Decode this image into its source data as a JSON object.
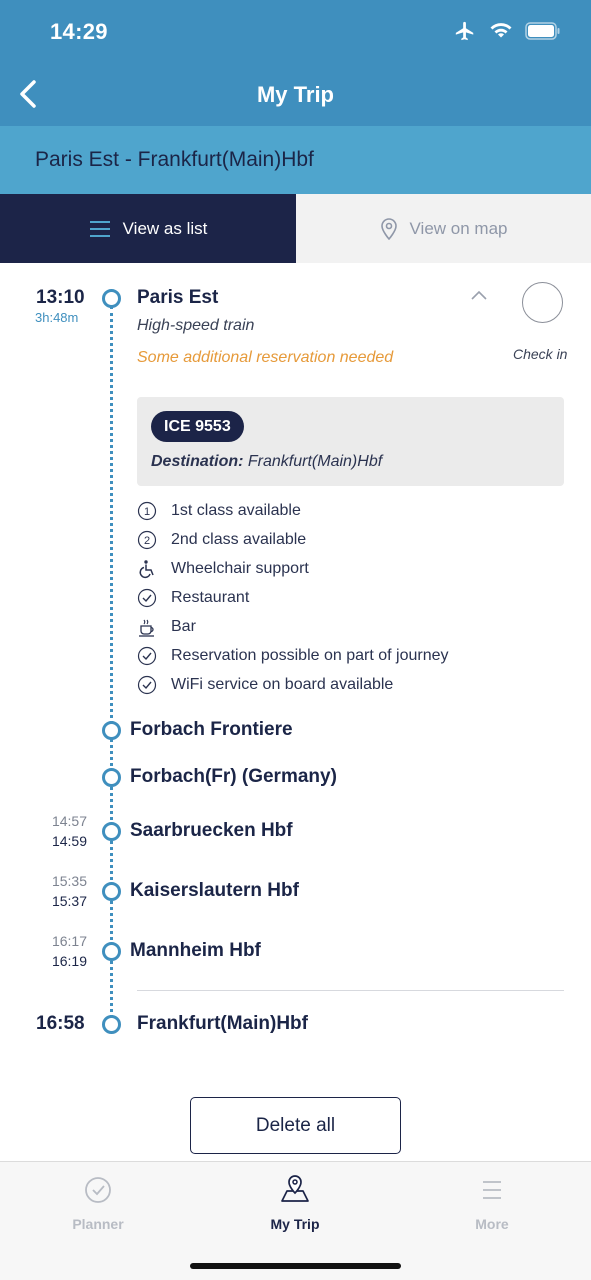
{
  "status": {
    "time": "14:29",
    "icons": [
      "airplane-icon",
      "wifi-icon",
      "battery-icon"
    ]
  },
  "nav": {
    "title": "My Trip",
    "back_icon": "chevron-left-icon"
  },
  "route": {
    "title": "Paris Est - Frankfurt(Main)Hbf"
  },
  "tabs": {
    "list_label": "View as list",
    "map_label": "View on map"
  },
  "origin": {
    "time": "13:10",
    "duration": "3h:48m",
    "name": "Paris Est",
    "train_type": "High-speed train",
    "reservation_note": "Some additional reservation needed",
    "checkin_label": "Check in"
  },
  "train": {
    "number": "ICE 9553",
    "destination_label": "Destination:",
    "destination": "Frankfurt(Main)Hbf"
  },
  "features": [
    {
      "icon": "number-1-icon",
      "label": "1st class available"
    },
    {
      "icon": "number-2-icon",
      "label": "2nd class available"
    },
    {
      "icon": "wheelchair-icon",
      "label": "Wheelchair support"
    },
    {
      "icon": "check-circle-icon",
      "label": "Restaurant"
    },
    {
      "icon": "coffee-cup-icon",
      "label": "Bar"
    },
    {
      "icon": "check-circle-icon",
      "label": "Reservation possible on part of journey"
    },
    {
      "icon": "check-circle-icon",
      "label": "WiFi service on board available"
    }
  ],
  "stops": [
    {
      "name": "Forbach Frontiere",
      "arrival": "",
      "departure": ""
    },
    {
      "name": "Forbach(Fr) (Germany)",
      "arrival": "",
      "departure": ""
    },
    {
      "name": "Saarbruecken Hbf",
      "arrival": "14:57",
      "departure": "14:59"
    },
    {
      "name": "Kaiserslautern Hbf",
      "arrival": "15:35",
      "departure": "15:37"
    },
    {
      "name": "Mannheim Hbf",
      "arrival": "16:17",
      "departure": "16:19"
    }
  ],
  "destination": {
    "time": "16:58",
    "name": "Frankfurt(Main)Hbf"
  },
  "actions": {
    "delete_label": "Delete all"
  },
  "tabbar": {
    "planner": "Planner",
    "mytrip": "My Trip",
    "more": "More"
  },
  "colors": {
    "primary": "#3f8fbe",
    "navy": "#1c2448",
    "route_bar": "#4fa5cd",
    "warning": "#e69a3a"
  }
}
